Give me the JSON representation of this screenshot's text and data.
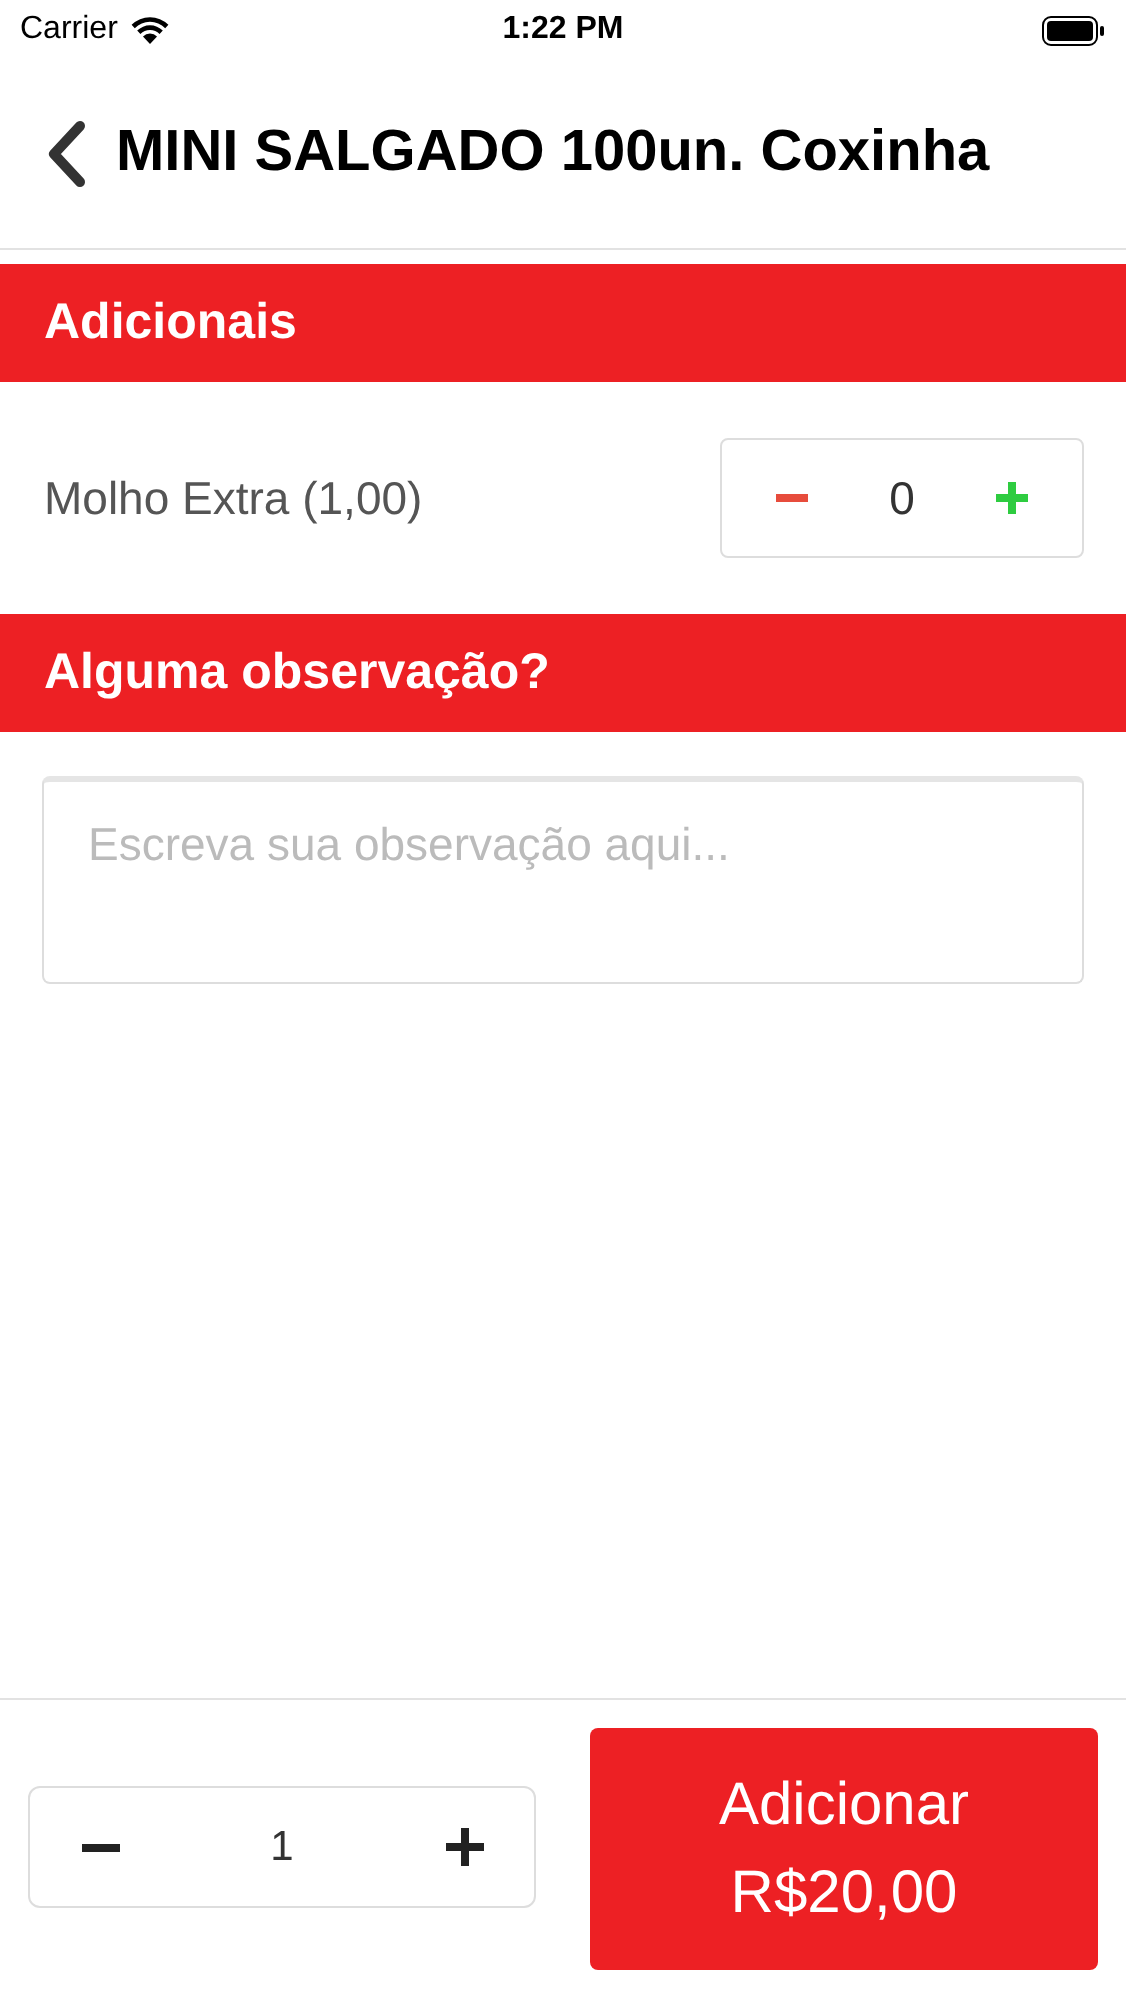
{
  "status_bar": {
    "carrier": "Carrier",
    "time": "1:22 PM"
  },
  "header": {
    "title": "MINI SALGADO 100un. Coxinha"
  },
  "addons": {
    "title": "Adicionais",
    "items": [
      {
        "name": "Molho Extra (1,00)",
        "quantity": "0"
      }
    ]
  },
  "note": {
    "title": "Alguma observação?",
    "placeholder": "Escreva sua observação aqui..."
  },
  "footer": {
    "quantity": "1",
    "button_lines": [
      "Adicionar",
      "R$20,00"
    ]
  }
}
